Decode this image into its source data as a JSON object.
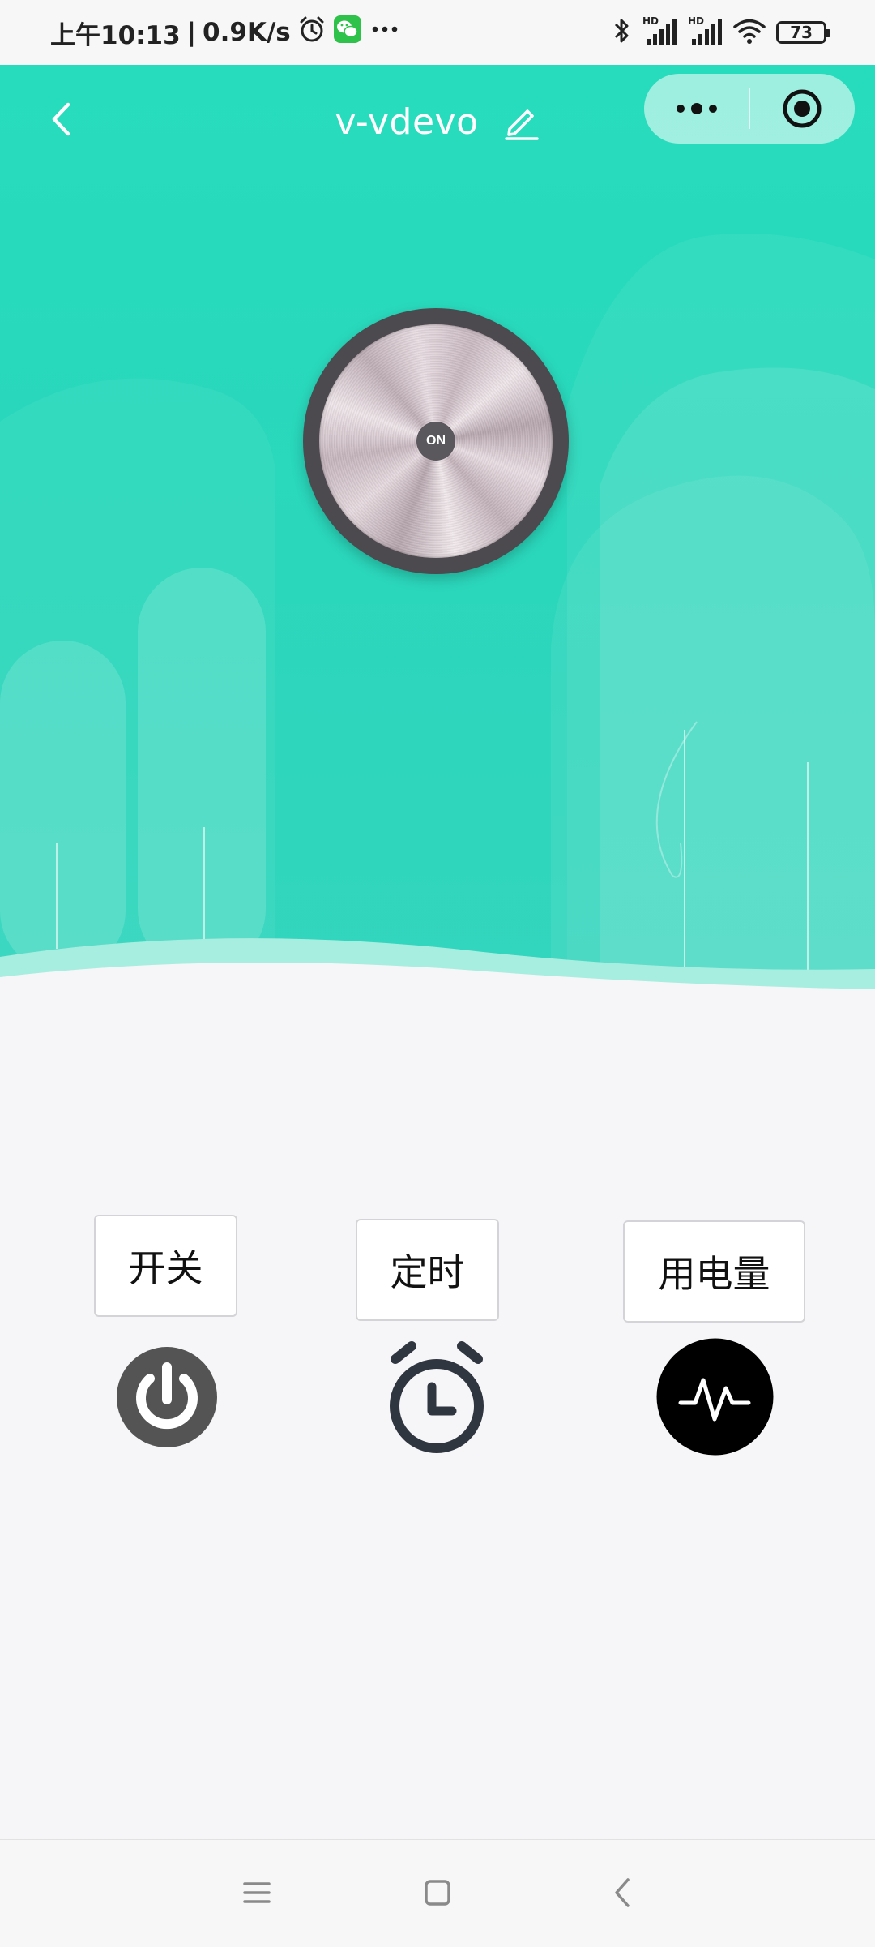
{
  "status_bar": {
    "time": "上午10:13",
    "separator": "|",
    "network_speed": "0.9K/s",
    "battery": "73",
    "signal_labels": [
      "HD",
      "HD"
    ],
    "left_icons": [
      "alarm-icon",
      "wechat-icon",
      "more-dots-icon"
    ],
    "right_icons": [
      "bluetooth-icon",
      "signal-icon",
      "signal-icon",
      "wifi-icon",
      "battery-icon"
    ]
  },
  "header": {
    "title": "v-vdevo",
    "back_icon": "back-arrow-icon",
    "edit_icon": "pencil-icon",
    "menu_icon": "more-dots-icon",
    "close_icon": "target-icon"
  },
  "knob": {
    "label": "ON"
  },
  "controls": {
    "switch_label": "开关",
    "timer_label": "定时",
    "usage_label": "用电量"
  },
  "colors": {
    "accent": "#2ad7bb",
    "knob_ring": "#4c4a4f",
    "power_icon": "#545454",
    "timer_icon": "#2f3640",
    "usage_icon": "#000000"
  },
  "nav_bar": {
    "icons": [
      "menu-icon",
      "home-icon",
      "back-icon"
    ]
  }
}
